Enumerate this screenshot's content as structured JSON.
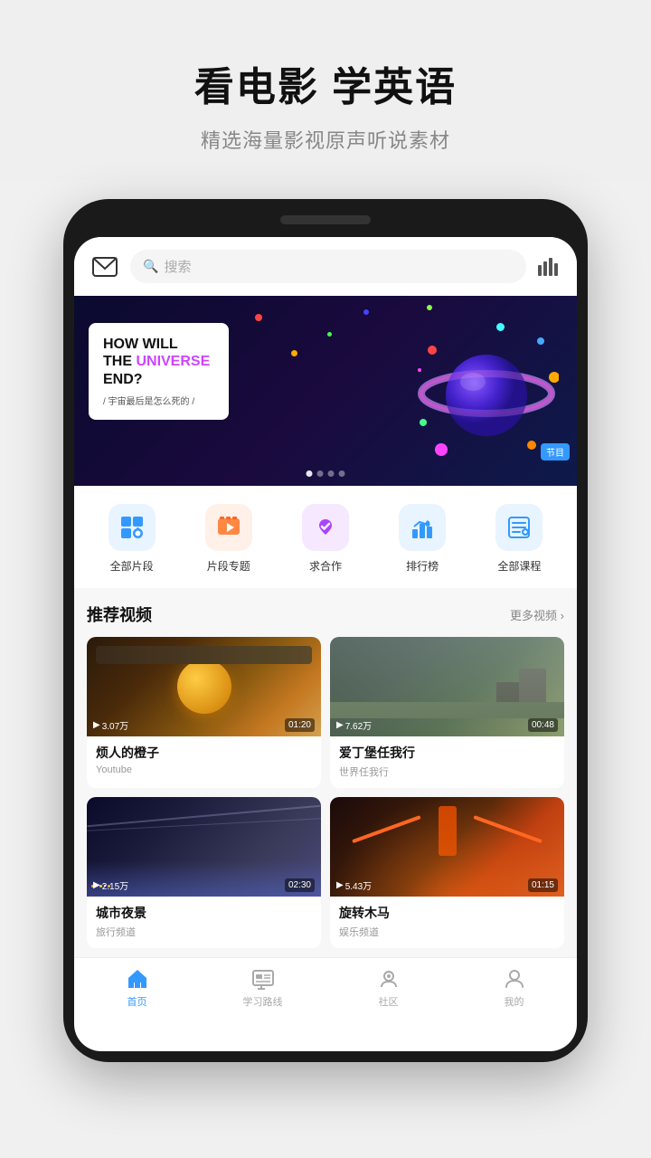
{
  "header": {
    "title": "看电影 学英语",
    "subtitle": "精选海量影视原声听说素材"
  },
  "searchBar": {
    "placeholder": "搜索"
  },
  "banner": {
    "titleLine1": "HOW WILL",
    "titleMiddle1": "THE ",
    "titleUniverse": "UNIVERSE",
    "titleMiddle2": "",
    "titleLine2": "END?",
    "subtitle": "/ 宇宙最后是怎么死的 /",
    "tag": "节目",
    "dots": [
      true,
      false,
      false,
      false
    ]
  },
  "quickActions": [
    {
      "id": "all-clips",
      "label": "全部片段",
      "color": "#3399ff"
    },
    {
      "id": "clip-topics",
      "label": "片段专题",
      "color": "#ff6600"
    },
    {
      "id": "cooperate",
      "label": "求合作",
      "color": "#cc44ff"
    },
    {
      "id": "ranking",
      "label": "排行榜",
      "color": "#3399ff"
    },
    {
      "id": "all-courses",
      "label": "全部课程",
      "color": "#3399ff"
    }
  ],
  "recommendedSection": {
    "title": "推荐视频",
    "moreLabel": "更多视频 ›"
  },
  "videos": [
    {
      "id": "v1",
      "title": "烦人的橙子",
      "source": "Youtube",
      "views": "3.07万",
      "duration": "01:20",
      "thumbType": "orange"
    },
    {
      "id": "v2",
      "title": "爱丁堡任我行",
      "source": "世界任我行",
      "views": "7.62万",
      "duration": "00:48",
      "thumbType": "castle"
    },
    {
      "id": "v3",
      "title": "城市夜景",
      "source": "旅行频道",
      "views": "2.15万",
      "duration": "02:30",
      "thumbType": "city"
    },
    {
      "id": "v4",
      "title": "旋转木马",
      "source": "娱乐频道",
      "views": "5.43万",
      "duration": "01:15",
      "thumbType": "carousel"
    }
  ],
  "bottomNav": [
    {
      "id": "home",
      "label": "首页",
      "active": true
    },
    {
      "id": "learning",
      "label": "学习路线",
      "active": false
    },
    {
      "id": "community",
      "label": "社区",
      "active": false
    },
    {
      "id": "profile",
      "label": "我的",
      "active": false
    }
  ],
  "icons": {
    "play": "▶",
    "search": "🔍",
    "bars": "📊"
  }
}
